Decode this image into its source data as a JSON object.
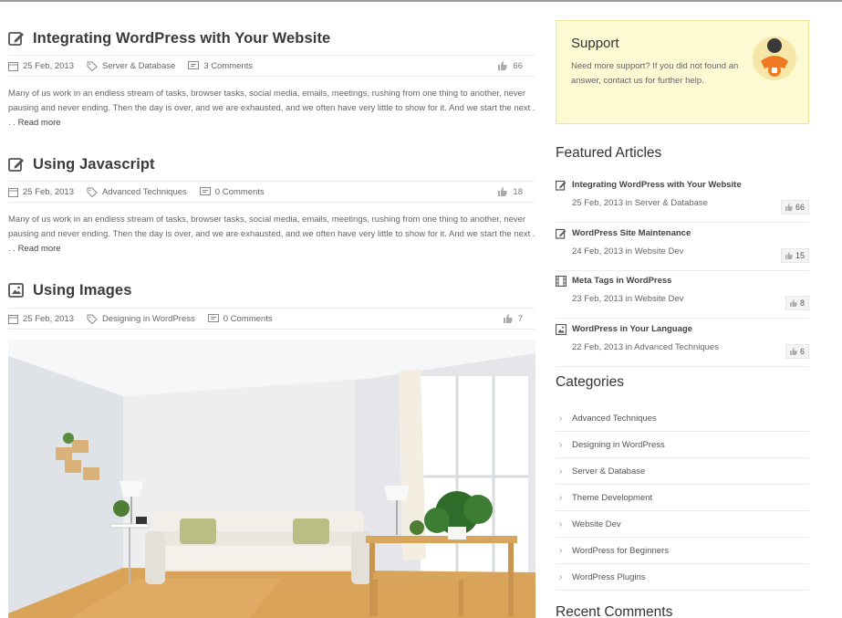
{
  "posts": [
    {
      "title": "Integrating WordPress with Your Website",
      "icon": "edit-icon",
      "date": "25 Feb, 2013",
      "category": "Server & Database",
      "comments": "3 Comments",
      "likes": "66",
      "excerpt": "Many of us work in an endless stream of tasks, browser tasks, social media, emails, meetings, rushing from one thing to another, never pausing and never ending. Then the day is over, and we are exhausted, and we often have very little to show for it. And we start the next . . . ",
      "read_more": "Read more"
    },
    {
      "title": "Using Javascript",
      "icon": "edit-icon",
      "date": "25 Feb, 2013",
      "category": "Advanced Techniques",
      "comments": "0 Comments",
      "likes": "18",
      "excerpt": "Many of us work in an endless stream of tasks, browser tasks, social media, emails, meetings, rushing from one thing to another, never pausing and never ending. Then the day is over, and we are exhausted, and we often have very little to show for it. And we start the next . . . ",
      "read_more": "Read more"
    },
    {
      "title": "Using Images",
      "icon": "image-icon",
      "date": "25 Feb, 2013",
      "category": "Designing in WordPress",
      "comments": "0 Comments",
      "likes": "7"
    }
  ],
  "sidebar": {
    "support": {
      "title": "Support",
      "text": "Need more support? If you did not found an answer, contact us for further help."
    },
    "featured_title": "Featured Articles",
    "featured": [
      {
        "title": "Integrating WordPress with Your Website",
        "date": "25 Feb, 2013",
        "in": "in",
        "category": "Server & Database",
        "count": "66",
        "icon": "edit-icon"
      },
      {
        "title": "WordPress Site Maintenance",
        "date": "24 Feb, 2013",
        "in": "in",
        "category": "Website Dev",
        "count": "15",
        "icon": "edit-icon"
      },
      {
        "title": "Meta Tags in WordPress",
        "date": "23 Feb, 2013",
        "in": "in",
        "category": "Website Dev",
        "count": "8",
        "icon": "film-icon"
      },
      {
        "title": "WordPress in Your Language",
        "date": "22 Feb, 2013",
        "in": "in",
        "category": "Advanced Techniques",
        "count": "6",
        "icon": "image-icon"
      }
    ],
    "categories_title": "Categories",
    "categories": [
      "Advanced Techniques",
      "Designing in WordPress",
      "Server & Database",
      "Theme Development",
      "Website Dev",
      "WordPress for Beginners",
      "WordPress Plugins"
    ],
    "recent_comments_title": "Recent Comments"
  }
}
